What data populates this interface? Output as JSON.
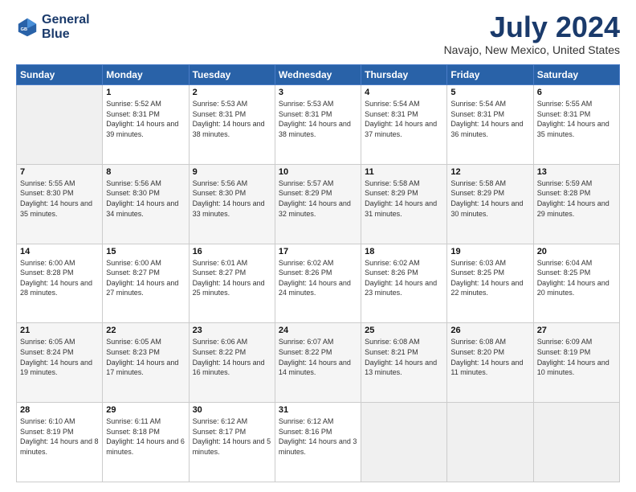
{
  "logo": {
    "line1": "General",
    "line2": "Blue"
  },
  "title": "July 2024",
  "subtitle": "Navajo, New Mexico, United States",
  "days_of_week": [
    "Sunday",
    "Monday",
    "Tuesday",
    "Wednesday",
    "Thursday",
    "Friday",
    "Saturday"
  ],
  "weeks": [
    [
      {
        "day": "",
        "sunrise": "",
        "sunset": "",
        "daylight": "",
        "empty": true
      },
      {
        "day": "1",
        "sunrise": "Sunrise: 5:52 AM",
        "sunset": "Sunset: 8:31 PM",
        "daylight": "Daylight: 14 hours and 39 minutes."
      },
      {
        "day": "2",
        "sunrise": "Sunrise: 5:53 AM",
        "sunset": "Sunset: 8:31 PM",
        "daylight": "Daylight: 14 hours and 38 minutes."
      },
      {
        "day": "3",
        "sunrise": "Sunrise: 5:53 AM",
        "sunset": "Sunset: 8:31 PM",
        "daylight": "Daylight: 14 hours and 38 minutes."
      },
      {
        "day": "4",
        "sunrise": "Sunrise: 5:54 AM",
        "sunset": "Sunset: 8:31 PM",
        "daylight": "Daylight: 14 hours and 37 minutes."
      },
      {
        "day": "5",
        "sunrise": "Sunrise: 5:54 AM",
        "sunset": "Sunset: 8:31 PM",
        "daylight": "Daylight: 14 hours and 36 minutes."
      },
      {
        "day": "6",
        "sunrise": "Sunrise: 5:55 AM",
        "sunset": "Sunset: 8:31 PM",
        "daylight": "Daylight: 14 hours and 35 minutes."
      }
    ],
    [
      {
        "day": "7",
        "sunrise": "Sunrise: 5:55 AM",
        "sunset": "Sunset: 8:30 PM",
        "daylight": "Daylight: 14 hours and 35 minutes."
      },
      {
        "day": "8",
        "sunrise": "Sunrise: 5:56 AM",
        "sunset": "Sunset: 8:30 PM",
        "daylight": "Daylight: 14 hours and 34 minutes."
      },
      {
        "day": "9",
        "sunrise": "Sunrise: 5:56 AM",
        "sunset": "Sunset: 8:30 PM",
        "daylight": "Daylight: 14 hours and 33 minutes."
      },
      {
        "day": "10",
        "sunrise": "Sunrise: 5:57 AM",
        "sunset": "Sunset: 8:29 PM",
        "daylight": "Daylight: 14 hours and 32 minutes."
      },
      {
        "day": "11",
        "sunrise": "Sunrise: 5:58 AM",
        "sunset": "Sunset: 8:29 PM",
        "daylight": "Daylight: 14 hours and 31 minutes."
      },
      {
        "day": "12",
        "sunrise": "Sunrise: 5:58 AM",
        "sunset": "Sunset: 8:29 PM",
        "daylight": "Daylight: 14 hours and 30 minutes."
      },
      {
        "day": "13",
        "sunrise": "Sunrise: 5:59 AM",
        "sunset": "Sunset: 8:28 PM",
        "daylight": "Daylight: 14 hours and 29 minutes."
      }
    ],
    [
      {
        "day": "14",
        "sunrise": "Sunrise: 6:00 AM",
        "sunset": "Sunset: 8:28 PM",
        "daylight": "Daylight: 14 hours and 28 minutes."
      },
      {
        "day": "15",
        "sunrise": "Sunrise: 6:00 AM",
        "sunset": "Sunset: 8:27 PM",
        "daylight": "Daylight: 14 hours and 27 minutes."
      },
      {
        "day": "16",
        "sunrise": "Sunrise: 6:01 AM",
        "sunset": "Sunset: 8:27 PM",
        "daylight": "Daylight: 14 hours and 25 minutes."
      },
      {
        "day": "17",
        "sunrise": "Sunrise: 6:02 AM",
        "sunset": "Sunset: 8:26 PM",
        "daylight": "Daylight: 14 hours and 24 minutes."
      },
      {
        "day": "18",
        "sunrise": "Sunrise: 6:02 AM",
        "sunset": "Sunset: 8:26 PM",
        "daylight": "Daylight: 14 hours and 23 minutes."
      },
      {
        "day": "19",
        "sunrise": "Sunrise: 6:03 AM",
        "sunset": "Sunset: 8:25 PM",
        "daylight": "Daylight: 14 hours and 22 minutes."
      },
      {
        "day": "20",
        "sunrise": "Sunrise: 6:04 AM",
        "sunset": "Sunset: 8:25 PM",
        "daylight": "Daylight: 14 hours and 20 minutes."
      }
    ],
    [
      {
        "day": "21",
        "sunrise": "Sunrise: 6:05 AM",
        "sunset": "Sunset: 8:24 PM",
        "daylight": "Daylight: 14 hours and 19 minutes."
      },
      {
        "day": "22",
        "sunrise": "Sunrise: 6:05 AM",
        "sunset": "Sunset: 8:23 PM",
        "daylight": "Daylight: 14 hours and 17 minutes."
      },
      {
        "day": "23",
        "sunrise": "Sunrise: 6:06 AM",
        "sunset": "Sunset: 8:22 PM",
        "daylight": "Daylight: 14 hours and 16 minutes."
      },
      {
        "day": "24",
        "sunrise": "Sunrise: 6:07 AM",
        "sunset": "Sunset: 8:22 PM",
        "daylight": "Daylight: 14 hours and 14 minutes."
      },
      {
        "day": "25",
        "sunrise": "Sunrise: 6:08 AM",
        "sunset": "Sunset: 8:21 PM",
        "daylight": "Daylight: 14 hours and 13 minutes."
      },
      {
        "day": "26",
        "sunrise": "Sunrise: 6:08 AM",
        "sunset": "Sunset: 8:20 PM",
        "daylight": "Daylight: 14 hours and 11 minutes."
      },
      {
        "day": "27",
        "sunrise": "Sunrise: 6:09 AM",
        "sunset": "Sunset: 8:19 PM",
        "daylight": "Daylight: 14 hours and 10 minutes."
      }
    ],
    [
      {
        "day": "28",
        "sunrise": "Sunrise: 6:10 AM",
        "sunset": "Sunset: 8:19 PM",
        "daylight": "Daylight: 14 hours and 8 minutes."
      },
      {
        "day": "29",
        "sunrise": "Sunrise: 6:11 AM",
        "sunset": "Sunset: 8:18 PM",
        "daylight": "Daylight: 14 hours and 6 minutes."
      },
      {
        "day": "30",
        "sunrise": "Sunrise: 6:12 AM",
        "sunset": "Sunset: 8:17 PM",
        "daylight": "Daylight: 14 hours and 5 minutes."
      },
      {
        "day": "31",
        "sunrise": "Sunrise: 6:12 AM",
        "sunset": "Sunset: 8:16 PM",
        "daylight": "Daylight: 14 hours and 3 minutes."
      },
      {
        "day": "",
        "sunrise": "",
        "sunset": "",
        "daylight": "",
        "empty": true
      },
      {
        "day": "",
        "sunrise": "",
        "sunset": "",
        "daylight": "",
        "empty": true
      },
      {
        "day": "",
        "sunrise": "",
        "sunset": "",
        "daylight": "",
        "empty": true
      }
    ]
  ]
}
